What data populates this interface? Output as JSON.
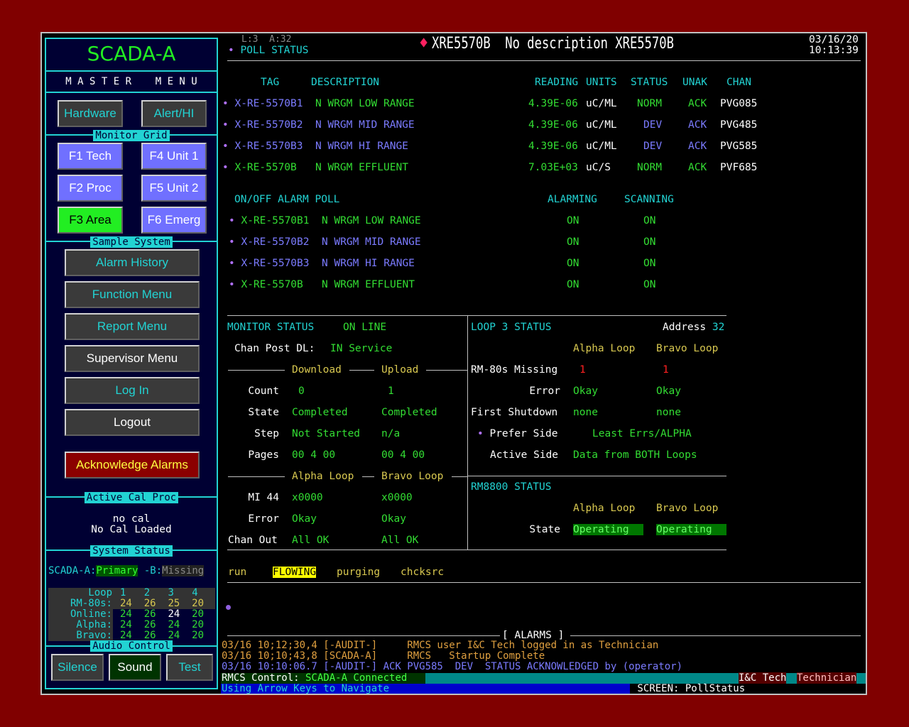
{
  "sidebar": {
    "title": "SCADA-A",
    "master_menu": "M A S T E R    M E N U",
    "hardware": "Hardware",
    "alert_hi": "Alert/HI",
    "monitor_grid": "Monitor Grid",
    "grid": [
      "F1 Tech",
      "F4 Unit 1",
      "F2 Proc",
      "F5 Unit 2",
      "F3 Area",
      "F6 Emerg"
    ],
    "sample_system": "Sample System",
    "menu": [
      "Alarm History",
      "Function Menu",
      "Report Menu",
      "Supervisor Menu",
      "Log In",
      "Logout"
    ],
    "ack_alarms": "Acknowledge Alarms",
    "active_cal_proc": "Active Cal Proc",
    "cal_line1": "no cal",
    "cal_line2": "No Cal Loaded",
    "system_status": "System  Status",
    "scada_a": "SCADA-A:",
    "primary": "Primary",
    "scada_b": " -B:",
    "missing": "Missing",
    "loop_table": {
      "labels": [
        "Loop",
        "RM-80s:",
        "Online:",
        "Alpha:",
        "Bravo:"
      ],
      "headers": [
        "1",
        "2",
        "3",
        "4"
      ],
      "rm80s": [
        "24",
        "26",
        "25",
        "20"
      ],
      "online": [
        "24",
        "26",
        "24",
        "20"
      ],
      "alpha": [
        "24",
        "26",
        "24",
        "20"
      ],
      "bravo": [
        "24",
        "26",
        "24",
        "20"
      ]
    },
    "audio_control": "Audio Control",
    "silence": "Silence",
    "sound": "Sound",
    "test": "Test"
  },
  "header": {
    "l_a": "L:3  A:32",
    "poll_status": "POLL STATUS",
    "title": "XRE5570B  No description XRE5570B",
    "date": "03/16/20",
    "time": "10:13:39"
  },
  "readings": {
    "headers": {
      "tag": "TAG",
      "description": "DESCRIPTION",
      "reading": "READING",
      "units": "UNITS",
      "status": "STATUS",
      "unak": "UNAK",
      "chan": "CHAN"
    },
    "rows": [
      {
        "tag": "X-RE-5570B1",
        "desc": "N WRGM LOW RANGE",
        "reading": "4.39E-06",
        "units": "uC/ML",
        "status": "NORM",
        "unak": "ACK",
        "chan": "PVG085"
      },
      {
        "tag": "X-RE-5570B2",
        "desc": "N WRGM MID RANGE",
        "reading": "4.39E-06",
        "units": "uC/ML",
        "status": "DEV",
        "unak": "ACK",
        "chan": "PVG485"
      },
      {
        "tag": "X-RE-5570B3",
        "desc": "N WRGM HI RANGE",
        "reading": "4.39E-06",
        "units": "uC/ML",
        "status": "DEV",
        "unak": "ACK",
        "chan": "PVG585"
      },
      {
        "tag": "X-RE-5570B",
        "desc": "N WRGM EFFLUENT",
        "reading": "7.03E+03",
        "units": "uC/S",
        "status": "NORM",
        "unak": "ACK",
        "chan": "PVF685"
      }
    ]
  },
  "alarm_poll": {
    "title": "ON/OFF ALARM POLL",
    "alarming": "ALARMING",
    "scanning": "SCANNING",
    "rows": [
      {
        "tag": "X-RE-5570B1",
        "desc": "N WRGM LOW RANGE",
        "alarming": "ON",
        "scanning": "ON"
      },
      {
        "tag": "X-RE-5570B2",
        "desc": "N WRGM MID RANGE",
        "alarming": "ON",
        "scanning": "ON"
      },
      {
        "tag": "X-RE-5570B3",
        "desc": "N WRGM HI RANGE",
        "alarming": "ON",
        "scanning": "ON"
      },
      {
        "tag": "X-RE-5570B",
        "desc": "N WRGM EFFLUENT",
        "alarming": "ON",
        "scanning": "ON"
      }
    ]
  },
  "monitor_status": {
    "title": "MONITOR STATUS",
    "state": "ON LINE",
    "chan_post_label": "Chan Post DL:",
    "chan_post_value": "IN Service",
    "download": "Download",
    "upload": "Upload",
    "count_label": "Count",
    "count_dl": "0",
    "count_ul": "1",
    "state_label": "State",
    "state_dl": "Completed",
    "state_ul": "Completed",
    "step_label": "Step",
    "step_dl": "Not Started",
    "step_ul": "n/a",
    "pages_label": "Pages",
    "pages_dl": "00 4 00",
    "pages_ul": "00 4 00",
    "alpha_loop": "Alpha Loop",
    "bravo_loop": "Bravo Loop",
    "mi_label": "MI 44",
    "mi_alpha": "x0000",
    "mi_bravo": "x0000",
    "error_label": "Error",
    "error_alpha": "Okay",
    "error_bravo": "Okay",
    "chanout_label": "Chan Out",
    "chanout_alpha": "All OK",
    "chanout_bravo": "All OK"
  },
  "loop_status": {
    "title": "LOOP 3 STATUS",
    "address_label": "Address",
    "address": "32",
    "alpha_loop": "Alpha Loop",
    "bravo_loop": "Bravo Loop",
    "rm80_label": "RM-80s Missing",
    "rm80_alpha": "1",
    "rm80_bravo": "1",
    "error_label": "Error",
    "error_alpha": "Okay",
    "error_bravo": "Okay",
    "first_shutdown_label": "First Shutdown",
    "first_alpha": "none",
    "first_bravo": "none",
    "prefer_label": "Prefer Side",
    "prefer_value": "Least Errs/ALPHA",
    "active_label": "Active Side",
    "active_value": "Data from BOTH Loops"
  },
  "rm8800": {
    "title": "RM8800 STATUS",
    "alpha_loop": "Alpha Loop",
    "bravo_loop": "Bravo Loop",
    "state_label": "State",
    "state_alpha": "Operating",
    "state_bravo": "Operating"
  },
  "run_line": {
    "run": "run",
    "flowing": "FLOWING",
    "purging": "purging",
    "chcksrc": "chcksrc"
  },
  "alarms": {
    "title": "[ ALARMS ]",
    "lines": [
      "03/16 10;12;30,4 [-AUDIT-]     RMCS user I&C Tech logged in as Technician",
      "03/16 10;10;43,8 [SCADA-A]     RMCS   Startup Complete",
      "03/16 10:10:06.7 [-AUDIT-] ACK PVG585  DEV  STATUS ACKNOWLEDGED by (operator)"
    ]
  },
  "statusbar": {
    "control": "RMCS Control:",
    "connected": " SCADA-A Connected",
    "user": "I&C Tech",
    "role": "Technician",
    "nav_hint": "Using Arrow Keys to Navigate",
    "screen": " SCREEN: PollStatus"
  }
}
